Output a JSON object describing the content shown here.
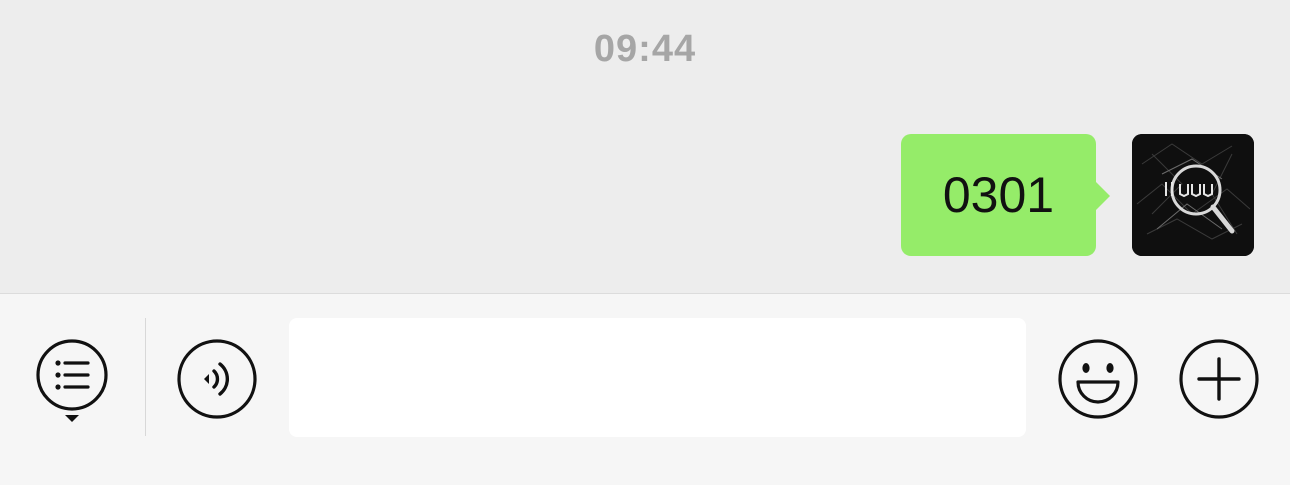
{
  "chat": {
    "timestamp": "09:44",
    "messages": [
      {
        "sender": "self",
        "text": "0301"
      }
    ]
  },
  "input_bar": {
    "menu_icon": "list-menu-icon",
    "voice_icon": "voice-icon",
    "emoji_icon": "emoji-icon",
    "add_icon": "plus-icon",
    "input_value": "",
    "input_placeholder": ""
  },
  "colors": {
    "background": "#ededed",
    "bubble_self": "#95ec69",
    "input_bar_bg": "#f6f6f6",
    "timestamp_text": "#a6a6a6"
  }
}
